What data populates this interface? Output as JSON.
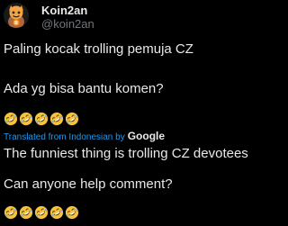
{
  "author": {
    "display_name": "Koin2an",
    "handle": "@koin2an",
    "avatar_icon": "bitcoin-character-avatar"
  },
  "original": {
    "line1": "Paling kocak trolling pemuja CZ",
    "line2": "Ada yg bisa bantu komen?",
    "emoji_icon": "rolling-on-floor-laughing-emoji",
    "emoji_count": 5
  },
  "translation": {
    "label": "Translated from Indonesian by",
    "provider": "Google",
    "line1": "The funniest thing is trolling CZ devotees",
    "line2": "Can anyone help comment?",
    "emoji_count": 5
  },
  "colors": {
    "background": "#000000",
    "text": "#e7e9ea",
    "secondary": "#71767b",
    "link": "#1d9bf0",
    "emoji_face": "#f7c23c"
  }
}
